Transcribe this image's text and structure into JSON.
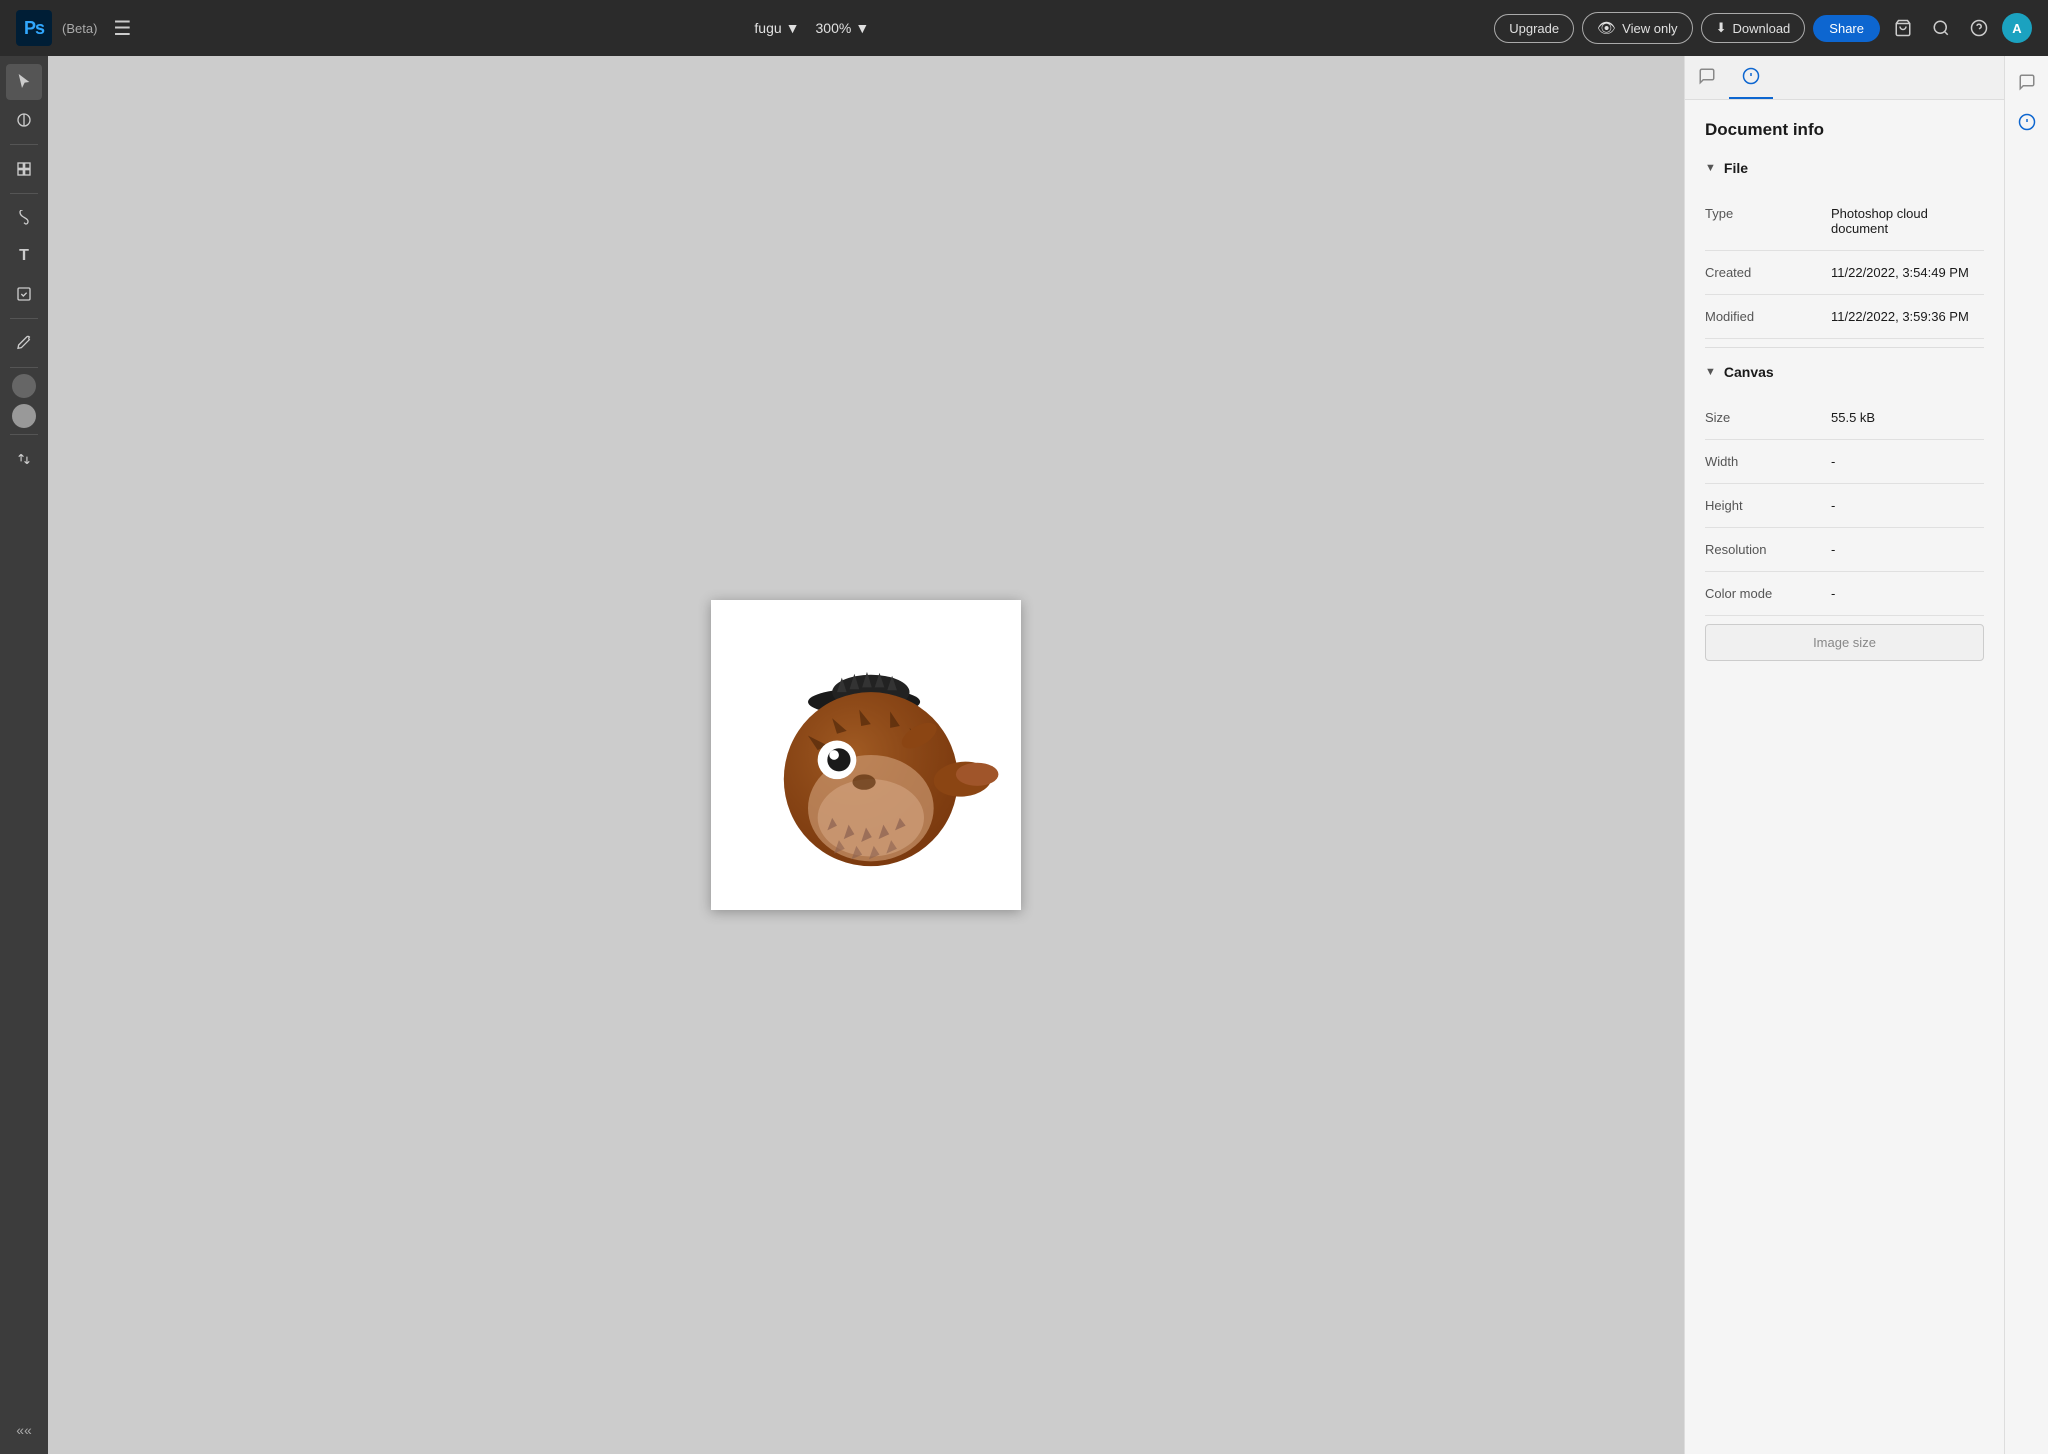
{
  "app": {
    "name": "Ps",
    "beta": "(Beta)",
    "title": "Adobe Photoshop"
  },
  "header": {
    "file_name": "fugu",
    "zoom": "300%",
    "upgrade_label": "Upgrade",
    "view_only_label": "View only",
    "download_label": "Download",
    "share_label": "Share"
  },
  "tools": [
    {
      "name": "select",
      "icon": "↖",
      "label": "Select"
    },
    {
      "name": "lasso",
      "icon": "⊖",
      "label": "Lasso"
    },
    {
      "name": "transform",
      "icon": "⊞",
      "label": "Transform"
    },
    {
      "name": "brush",
      "icon": "✏",
      "label": "Brush"
    },
    {
      "name": "text",
      "icon": "T",
      "label": "Text"
    },
    {
      "name": "shape",
      "icon": "⊕",
      "label": "Shape"
    },
    {
      "name": "eyedropper",
      "icon": "🔍",
      "label": "Eyedropper"
    }
  ],
  "panel": {
    "title": "Document info",
    "file_section": "File",
    "canvas_section": "Canvas",
    "type_label": "Type",
    "type_value": "Photoshop cloud document",
    "created_label": "Created",
    "created_value": "11/22/2022, 3:54:49 PM",
    "modified_label": "Modified",
    "modified_value": "11/22/2022, 3:59:36 PM",
    "size_label": "Size",
    "size_value": "55.5 kB",
    "width_label": "Width",
    "width_value": "-",
    "height_label": "Height",
    "height_value": "-",
    "resolution_label": "Resolution",
    "resolution_value": "-",
    "color_mode_label": "Color mode",
    "color_mode_value": "-",
    "image_size_label": "Image size"
  }
}
